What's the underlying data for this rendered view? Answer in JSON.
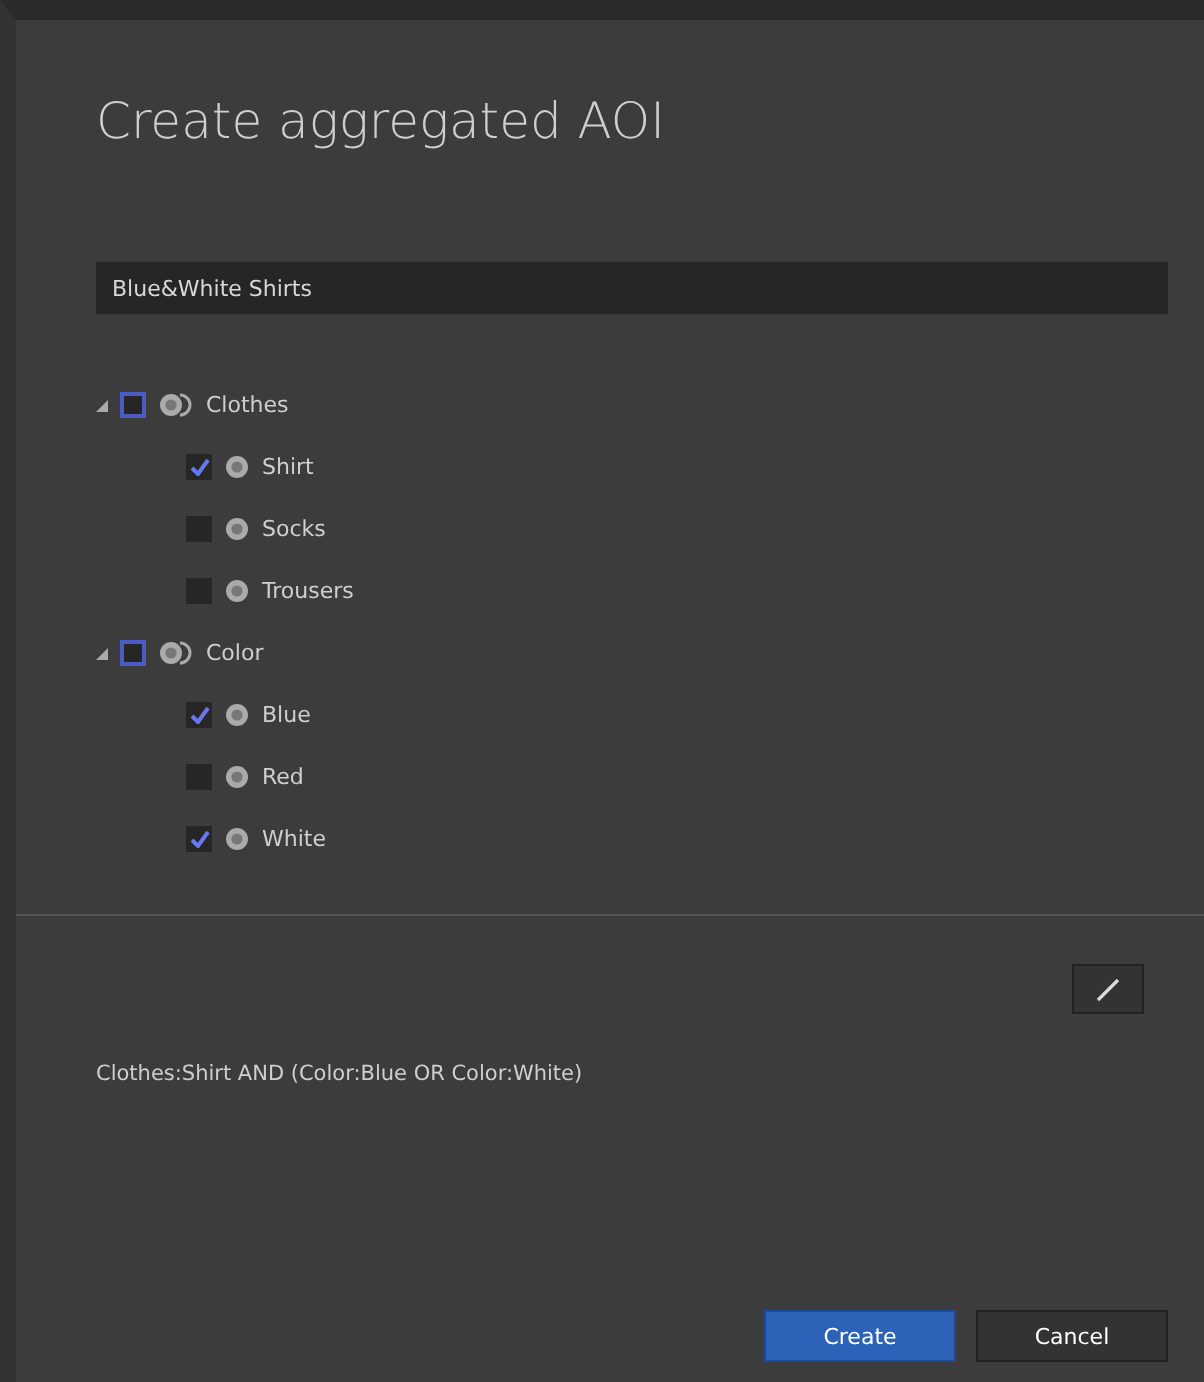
{
  "dialog": {
    "title": "Create aggregated AOI"
  },
  "name_field": {
    "value": "Blue&White Shirts"
  },
  "tree": [
    {
      "label": "Clothes",
      "expanded": true,
      "checked": false,
      "children": [
        {
          "label": "Shirt",
          "checked": true
        },
        {
          "label": "Socks",
          "checked": false
        },
        {
          "label": "Trousers",
          "checked": false
        }
      ]
    },
    {
      "label": "Color",
      "expanded": true,
      "checked": false,
      "children": [
        {
          "label": "Blue",
          "checked": true
        },
        {
          "label": "Red",
          "checked": false
        },
        {
          "label": "White",
          "checked": true
        }
      ]
    }
  ],
  "expression": "Clothes:Shirt AND (Color:Blue OR Color:White)",
  "buttons": [
    {
      "label": "Create",
      "kind": "primary"
    },
    {
      "label": "Cancel",
      "kind": "secondary"
    }
  ]
}
